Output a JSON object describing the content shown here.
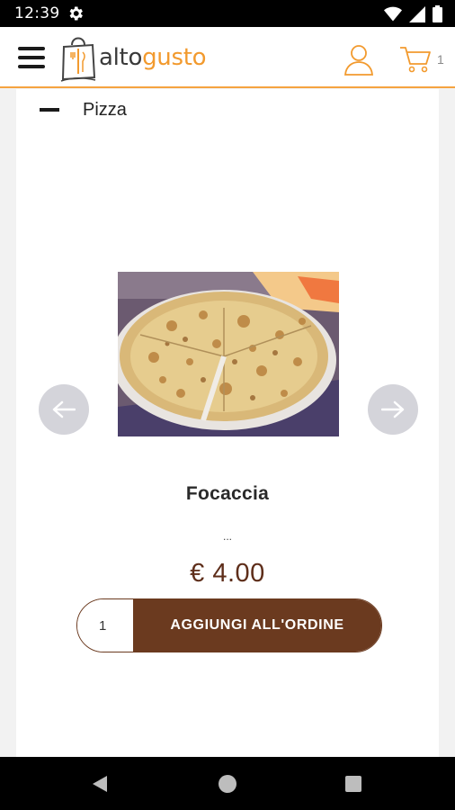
{
  "status_bar": {
    "time": "12:39",
    "icons": [
      "gear-icon",
      "wifi-icon",
      "signal-icon",
      "battery-icon"
    ]
  },
  "header": {
    "menu_icon": "hamburger-menu-icon",
    "logo_alto": "alto",
    "logo_gusto": "gusto",
    "user_icon": "user-icon",
    "cart_icon": "cart-icon",
    "cart_count": "1",
    "accent_color": "#f29a2e"
  },
  "category": {
    "label": "Pizza",
    "toggle_icon": "collapse-dash-icon"
  },
  "product": {
    "image_alt": "focaccia-pizza-photo",
    "name": "Focaccia",
    "description": "...",
    "price": "€ 4.00",
    "price_color": "#5e2e1a"
  },
  "carousel": {
    "prev_icon": "arrow-left-icon",
    "next_icon": "arrow-right-icon"
  },
  "order": {
    "quantity": "1",
    "add_label": "AGGIUNGI ALL'ORDINE",
    "button_color": "#6b3a1f"
  },
  "nav_bar": {
    "icons": [
      "back-triangle-icon",
      "home-circle-icon",
      "recent-square-icon"
    ]
  }
}
